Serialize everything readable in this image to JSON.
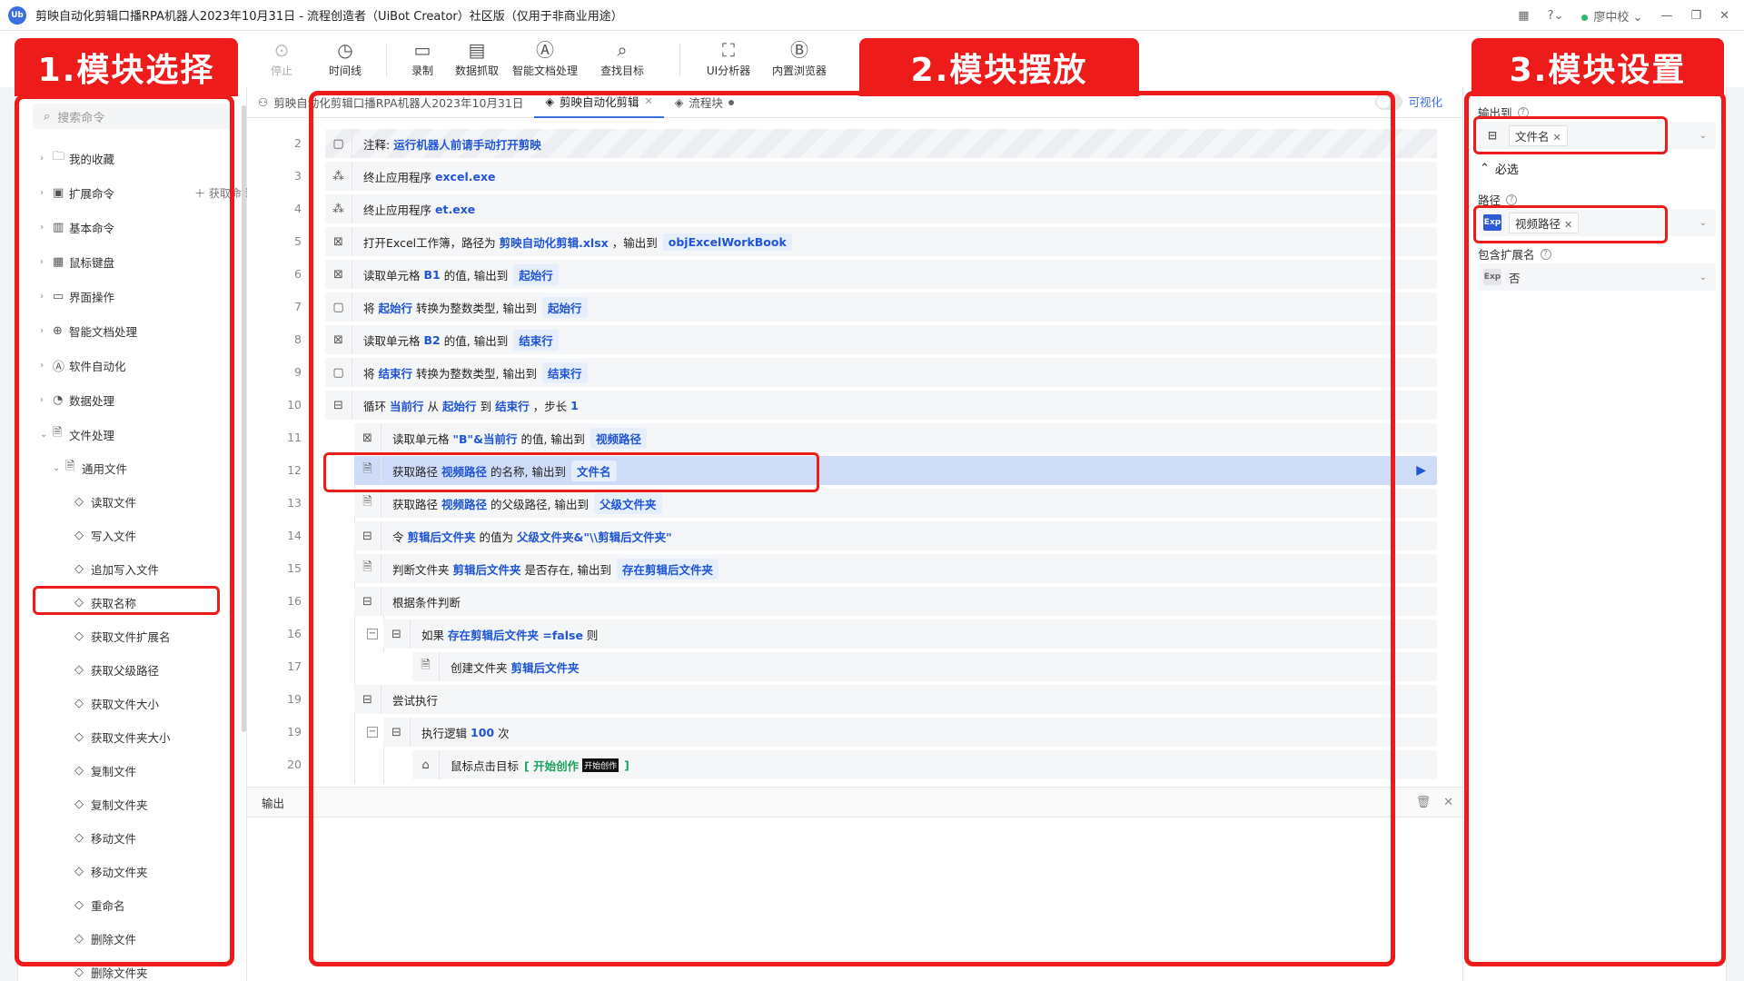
{
  "window": {
    "title": "剪映自动化剪辑口播RPA机器人2023年10月31日 - 流程创造者（UiBot Creator）社区版（仅用于非商业用途）",
    "app_icon": "Ub",
    "user": "廖中校"
  },
  "toolbar": {
    "stop": "停止",
    "timeline": "时间线",
    "record": "录制",
    "data_capture": "数据抓取",
    "smart_doc": "智能文档处理",
    "find_target": "查找目标",
    "ui_analyzer": "UI分析器",
    "browser": "内置浏览器"
  },
  "left_panel": {
    "search_placeholder": "搜索命令",
    "get_command": "获取命令",
    "items": [
      {
        "label": "我的收藏",
        "icon": "folder-icon"
      },
      {
        "label": "扩展命令",
        "icon": "extension-icon"
      },
      {
        "label": "基本命令",
        "icon": "basic-icon"
      },
      {
        "label": "鼠标键盘",
        "icon": "keyboard-icon"
      },
      {
        "label": "界面操作",
        "icon": "window-icon"
      },
      {
        "label": "智能文档处理",
        "icon": "ai-doc-icon"
      },
      {
        "label": "软件自动化",
        "icon": "app-icon"
      },
      {
        "label": "数据处理",
        "icon": "chart-icon"
      },
      {
        "label": "文件处理",
        "icon": "file-icon"
      },
      {
        "label": "通用文件",
        "icon": "file-icon"
      },
      {
        "label": "读取文件"
      },
      {
        "label": "写入文件"
      },
      {
        "label": "追加写入文件"
      },
      {
        "label": "获取名称"
      },
      {
        "label": "获取文件扩展名"
      },
      {
        "label": "获取父级路径"
      },
      {
        "label": "获取文件大小"
      },
      {
        "label": "获取文件夹大小"
      },
      {
        "label": "复制文件"
      },
      {
        "label": "复制文件夹"
      },
      {
        "label": "移动文件"
      },
      {
        "label": "移动文件夹"
      },
      {
        "label": "重命名"
      },
      {
        "label": "删除文件"
      },
      {
        "label": "删除文件夹"
      }
    ]
  },
  "editor": {
    "tabs": [
      {
        "label": "剪映自动化剪辑口播RPA机器人2023年10月31日"
      },
      {
        "label": "剪映自动化剪辑"
      },
      {
        "label": "流程块"
      }
    ],
    "visualize": "可视化",
    "output_label": "输出",
    "rows": [
      {
        "n": "2",
        "parts": [
          "注释:",
          "运行机器人前请手动打开剪映"
        ]
      },
      {
        "n": "3",
        "parts": [
          "终止应用程序",
          "excel.exe"
        ]
      },
      {
        "n": "4",
        "parts": [
          "终止应用程序",
          "et.exe"
        ]
      },
      {
        "n": "5",
        "parts": [
          "打开Excel工作簿，路径为",
          "剪映自动化剪辑.xlsx",
          "，输出到",
          "objExcelWorkBook"
        ]
      },
      {
        "n": "6",
        "parts": [
          "读取单元格",
          "B1",
          "的值, 输出到",
          "起始行"
        ]
      },
      {
        "n": "7",
        "parts": [
          "将",
          "起始行",
          "转换为整数类型, 输出到",
          "起始行"
        ]
      },
      {
        "n": "8",
        "parts": [
          "读取单元格",
          "B2",
          "的值, 输出到",
          "结束行"
        ]
      },
      {
        "n": "9",
        "parts": [
          "将",
          "结束行",
          "转换为整数类型, 输出到",
          "结束行"
        ]
      },
      {
        "n": "10",
        "parts": [
          "循环",
          "当前行",
          "从",
          "起始行",
          "到",
          "结束行",
          "，步长",
          "1"
        ]
      },
      {
        "n": "11",
        "parts": [
          "读取单元格",
          "\"B\"&当前行",
          "的值, 输出到",
          "视频路径"
        ]
      },
      {
        "n": "12",
        "parts": [
          "获取路径",
          "视频路径",
          "的名称, 输出到",
          "文件名"
        ]
      },
      {
        "n": "13",
        "parts": [
          "获取路径",
          "视频路径",
          "的父级路径, 输出到",
          "父级文件夹"
        ]
      },
      {
        "n": "14",
        "parts": [
          "令",
          "剪辑后文件夹",
          "的值为",
          "父级文件夹&\"\\\\剪辑后文件夹\""
        ]
      },
      {
        "n": "15",
        "parts": [
          "判断文件夹",
          "剪辑后文件夹",
          "是否存在, 输出到",
          "存在剪辑后文件夹"
        ]
      },
      {
        "n": "16",
        "parts": [
          "根据条件判断"
        ]
      },
      {
        "n": "16",
        "parts": [
          "如果",
          "存在剪辑后文件夹 =false",
          "则"
        ]
      },
      {
        "n": "17",
        "parts": [
          "创建文件夹",
          "剪辑后文件夹"
        ]
      },
      {
        "n": "19",
        "parts": [
          "尝试执行"
        ]
      },
      {
        "n": "19",
        "parts": [
          "执行逻辑",
          "100",
          "次"
        ]
      },
      {
        "n": "20",
        "parts": [
          "鼠标点击目标",
          "[ 开始创作",
          "开始创作",
          "]"
        ]
      }
    ]
  },
  "right_panel": {
    "output_to_label": "输出到",
    "output_to_value": "文件名",
    "required_section": "必选",
    "path_label": "路径",
    "path_value": "视频路径",
    "include_ext_label": "包含扩展名",
    "include_ext_value": "否",
    "exp_badge": "Exp"
  },
  "annotations": {
    "label_1": "1.模块选择",
    "label_2": "2.模块摆放",
    "label_3": "3.模块设置",
    "color": "#ee1b1b"
  },
  "colors": {
    "accent": "#1f55d6",
    "selected_row": "#cfdcf8",
    "green": "#1aa35d"
  }
}
